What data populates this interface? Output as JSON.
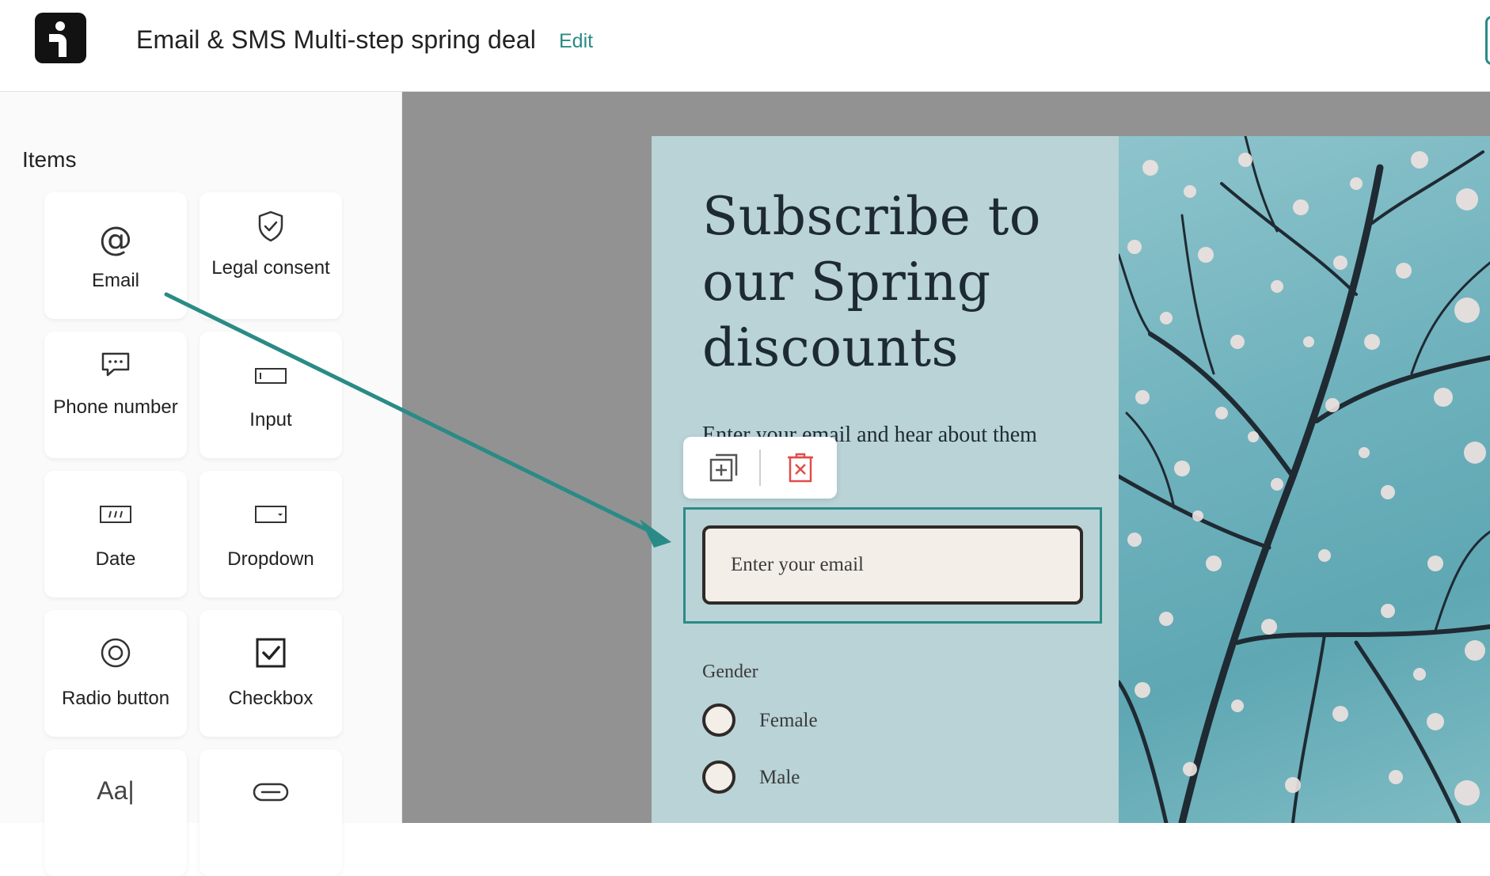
{
  "header": {
    "title": "Email & SMS Multi-step spring deal",
    "edit_label": "Edit"
  },
  "sidebar": {
    "title": "Items",
    "items": [
      {
        "label": "Email",
        "icon": "at-icon"
      },
      {
        "label": "Legal consent",
        "icon": "shield-check-icon"
      },
      {
        "label": "Phone number",
        "icon": "chat-bubble-icon"
      },
      {
        "label": "Input",
        "icon": "input-box-icon"
      },
      {
        "label": "Date",
        "icon": "date-field-icon"
      },
      {
        "label": "Dropdown",
        "icon": "dropdown-field-icon"
      },
      {
        "label": "Radio button",
        "icon": "radio-icon"
      },
      {
        "label": "Checkbox",
        "icon": "checkbox-icon"
      },
      {
        "label": "",
        "icon": "text-aa-icon"
      },
      {
        "label": "",
        "icon": "button-pill-icon"
      }
    ],
    "text_icon_glyph": "Aa|",
    "email_icon_glyph": "@"
  },
  "form": {
    "heading": "Subscribe to our Spring discounts",
    "subtext": "Enter your email and hear about them",
    "email_placeholder": "Enter your email",
    "gender_label": "Gender",
    "options": [
      "Female",
      "Male"
    ]
  },
  "colors": {
    "accent": "#2a8b86",
    "delete": "#e24b4b",
    "canvas": "#929292",
    "form_panel": "#b9d3d7",
    "input_fill": "#f4eee8"
  }
}
